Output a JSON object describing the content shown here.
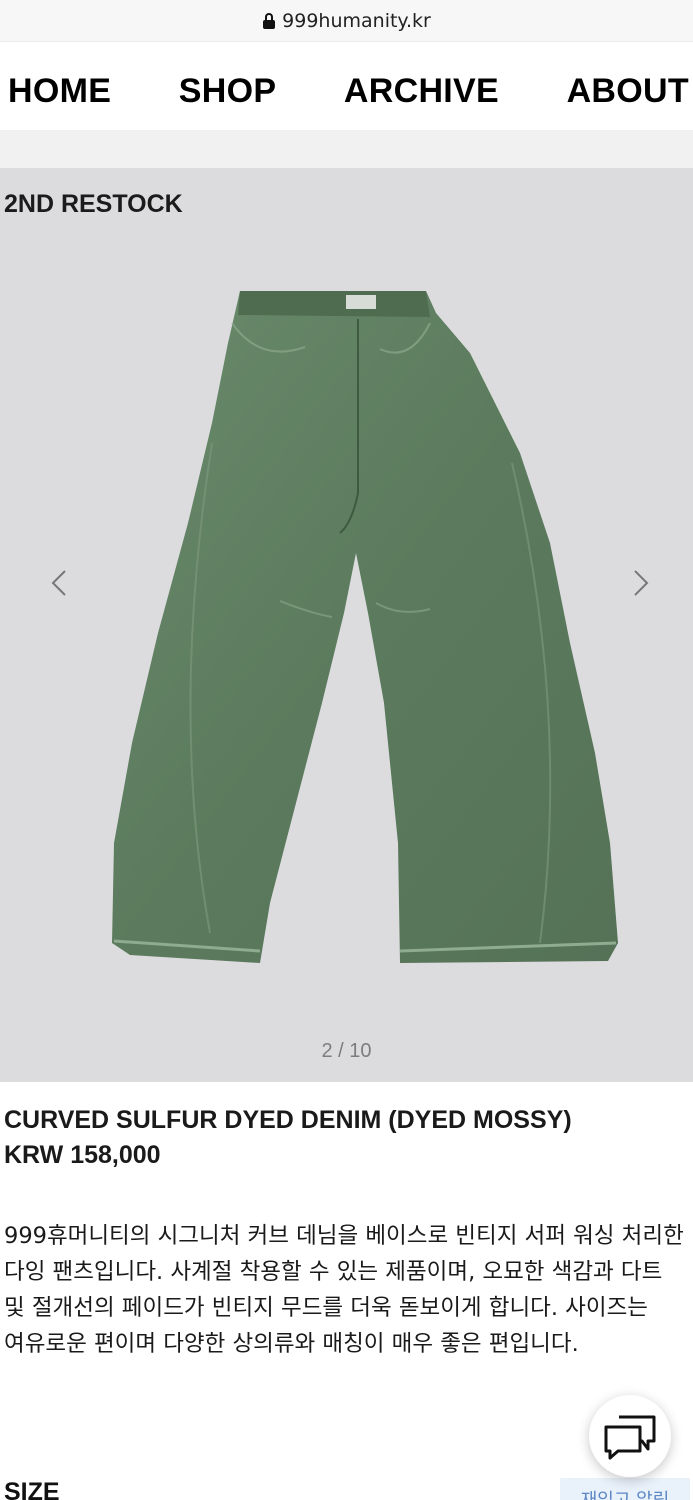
{
  "browser": {
    "url": "999humanity.kr",
    "lock_icon": "lock-icon"
  },
  "nav": {
    "items": [
      {
        "label": "HOME"
      },
      {
        "label": "SHOP"
      },
      {
        "label": "ARCHIVE"
      },
      {
        "label": "ABOUT"
      }
    ]
  },
  "gallery": {
    "badge": "2ND RESTOCK",
    "counter": "2 / 10",
    "prev_icon": "chevron-left-icon",
    "next_icon": "chevron-right-icon",
    "colors": {
      "background": "#dcdcde",
      "denim": "#5f7e61"
    }
  },
  "product": {
    "name": "CURVED SULFUR DYED DENIM (DYED MOSSY)",
    "price": "KRW 158,000",
    "description": "999휴머니티의 시그니처 커브 데님을 베이스로 빈티지 서퍼 워싱 처리한 다잉 팬츠입니다. 사계절 착용할 수 있는 제품이며, 오묘한 색감과 다트 및 절개선의 페이드가 빈티지 무드를 더욱 돋보이게 합니다. 사이즈는 여유로운 편이며 다양한 상의류와 매칭이 매우 좋은 편입니다.",
    "size_label": "SIZE",
    "restock_button": "재입고 알림"
  },
  "chat": {
    "icon": "chat-icon"
  }
}
